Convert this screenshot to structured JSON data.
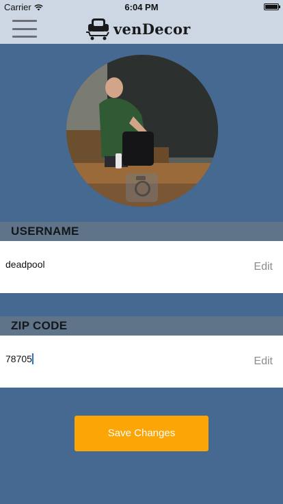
{
  "status_bar": {
    "carrier": "Carrier",
    "time": "6:04 PM"
  },
  "nav": {
    "brand_name": "venDecor",
    "menu_icon": "hamburger-menu-icon",
    "logo_icon": "armchair-cart-icon"
  },
  "profile": {
    "photo_icon": "profile-photo",
    "camera_icon": "camera-icon"
  },
  "username": {
    "header": "USERNAME",
    "value": "deadpool",
    "edit_label": "Edit"
  },
  "zip_code": {
    "header": "ZIP CODE",
    "value": "78705",
    "edit_label": "Edit"
  },
  "actions": {
    "save_label": "Save Changes"
  },
  "colors": {
    "background": "#456990",
    "bar": "#cdd7e4",
    "section_header": "#5f7389",
    "accent": "#fba606"
  }
}
